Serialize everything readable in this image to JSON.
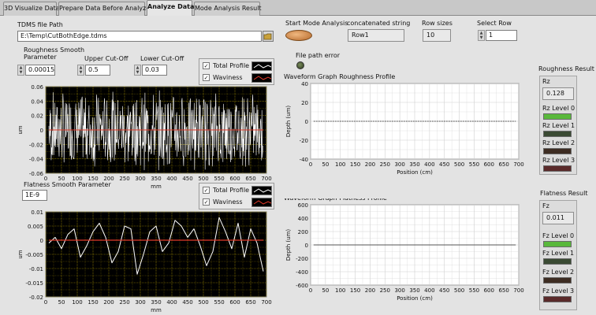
{
  "tabs": [
    {
      "label": "3D Visualize Data"
    },
    {
      "label": "Prepare Data Before Analyze"
    },
    {
      "label": "Analyze Data"
    },
    {
      "label": "Mode Analysis Result"
    }
  ],
  "tdms": {
    "label": "TDMS file Path",
    "value": "E:\\Temp\\CutBothEdge.tdms"
  },
  "roughness_params": {
    "smooth_label": "Roughness Smooth\nParameter",
    "smooth_value": "0.00015",
    "upper_label": "Upper Cut-Off",
    "upper_value": "0.5",
    "lower_label": "Lower Cut-Off",
    "lower_value": "0.03"
  },
  "legend": {
    "total": "Total Profile",
    "waviness": "Waviness"
  },
  "flatness_params": {
    "smooth_label": "Flatness Smooth Parameter",
    "smooth_value": "1E-9"
  },
  "controls": {
    "start_label": "Start Mode Analysis",
    "concat_label": "concatenated string",
    "concat_value": "Row1",
    "row_sizes_label": "Row sizes",
    "row_sizes_value": "10",
    "select_row_label": "Select Row",
    "select_row_value": "1",
    "file_error_label": "File path error"
  },
  "roughness_result": {
    "title": "Roughness Result",
    "rz_label": "Rz",
    "rz_value": "0.128",
    "levels": [
      "Rz Level 0",
      "Rz Level 1",
      "Rz Level 2",
      "Rz Level 3"
    ]
  },
  "flatness_result": {
    "title": "Flatness Result",
    "fz_label": "Fz",
    "fz_value": "0.011",
    "levels": [
      "Fz Level 0",
      "Fz Level 1",
      "Fz Level 2",
      "Fz Level 3"
    ]
  },
  "colors": {
    "level_on": "#59b83b",
    "level_off_dark": "#3a4a33",
    "level_red": "#5a2a2a",
    "plot_bg": "#000000",
    "grid": "#c8b400",
    "wave_red": "#e03a2a"
  },
  "chart_data": [
    {
      "type": "line",
      "name": "roughness-small",
      "xlabel": "mm",
      "ylabel": "um",
      "xlim": [
        0,
        700
      ],
      "ylim": [
        -0.06,
        0.06
      ],
      "xticks": [
        "0",
        "50",
        "100",
        "150",
        "200",
        "250",
        "300",
        "350",
        "400",
        "450",
        "500",
        "550",
        "600",
        "650",
        "700"
      ],
      "yticks": [
        "0.06",
        "0.04",
        "0.02",
        "0",
        "-0.02",
        "-0.04",
        "-0.06"
      ],
      "series": [
        {
          "name": "Total Profile",
          "pattern": "dense noise ±0.06"
        },
        {
          "name": "Waviness",
          "values_const": 0
        }
      ]
    },
    {
      "type": "line",
      "name": "flatness-small",
      "xlabel": "mm",
      "ylabel": "um",
      "xlim": [
        0,
        700
      ],
      "ylim": [
        -0.02,
        0.01
      ],
      "xticks": [
        "0",
        "50",
        "100",
        "150",
        "200",
        "250",
        "300",
        "350",
        "400",
        "450",
        "500",
        "550",
        "600",
        "650",
        "700"
      ],
      "yticks": [
        "0.01",
        "0.005",
        "0",
        "-0.005",
        "-0.01",
        "-0.015",
        "-0.02"
      ],
      "series": [
        {
          "name": "Total Profile",
          "x": [
            10,
            30,
            50,
            70,
            90,
            110,
            130,
            150,
            170,
            190,
            210,
            230,
            250,
            270,
            290,
            310,
            330,
            350,
            370,
            390,
            410,
            430,
            450,
            470,
            490,
            510,
            530,
            550,
            570,
            590,
            610,
            630,
            650,
            670,
            690
          ],
          "values": [
            -0.001,
            0.001,
            -0.003,
            0.002,
            0.004,
            -0.006,
            -0.002,
            0.003,
            0.006,
            0.001,
            -0.008,
            -0.004,
            0.005,
            0.004,
            -0.012,
            -0.005,
            0.003,
            0.005,
            -0.004,
            -0.001,
            0.007,
            0.005,
            0.001,
            0.004,
            -0.002,
            -0.009,
            -0.004,
            0.008,
            0.003,
            -0.003,
            0.006,
            -0.006,
            0.004,
            -0.001,
            -0.011
          ]
        },
        {
          "name": "Waviness",
          "values_const": 0
        }
      ]
    },
    {
      "type": "line",
      "name": "roughness-profile",
      "title": "Waveform Graph Roughness Profile",
      "xlabel": "Position (cm)",
      "ylabel": "Depth (um)",
      "xlim": [
        0,
        700
      ],
      "ylim": [
        -40,
        40
      ],
      "xticks": [
        "0",
        "50",
        "100",
        "150",
        "200",
        "250",
        "300",
        "350",
        "400",
        "450",
        "500",
        "550",
        "600",
        "650",
        "700"
      ],
      "yticks": [
        "40",
        "20",
        "0",
        "-20",
        "-40"
      ],
      "series": [
        {
          "x": [
            0,
            700
          ],
          "values": [
            0,
            0
          ]
        }
      ]
    },
    {
      "type": "line",
      "name": "flatness-profile",
      "title": "Waveform Graph Flatness Profile",
      "xlabel": "Position (cm)",
      "ylabel": "Depth (um)",
      "xlim": [
        0,
        700
      ],
      "ylim": [
        -600,
        600
      ],
      "xticks": [
        "0",
        "50",
        "100",
        "150",
        "200",
        "250",
        "300",
        "350",
        "400",
        "450",
        "500",
        "550",
        "600",
        "650",
        "700"
      ],
      "yticks": [
        "600",
        "400",
        "200",
        "0",
        "-200",
        "-400",
        "-600"
      ],
      "series": [
        {
          "x": [
            0,
            700
          ],
          "values": [
            0,
            0
          ]
        }
      ]
    }
  ]
}
